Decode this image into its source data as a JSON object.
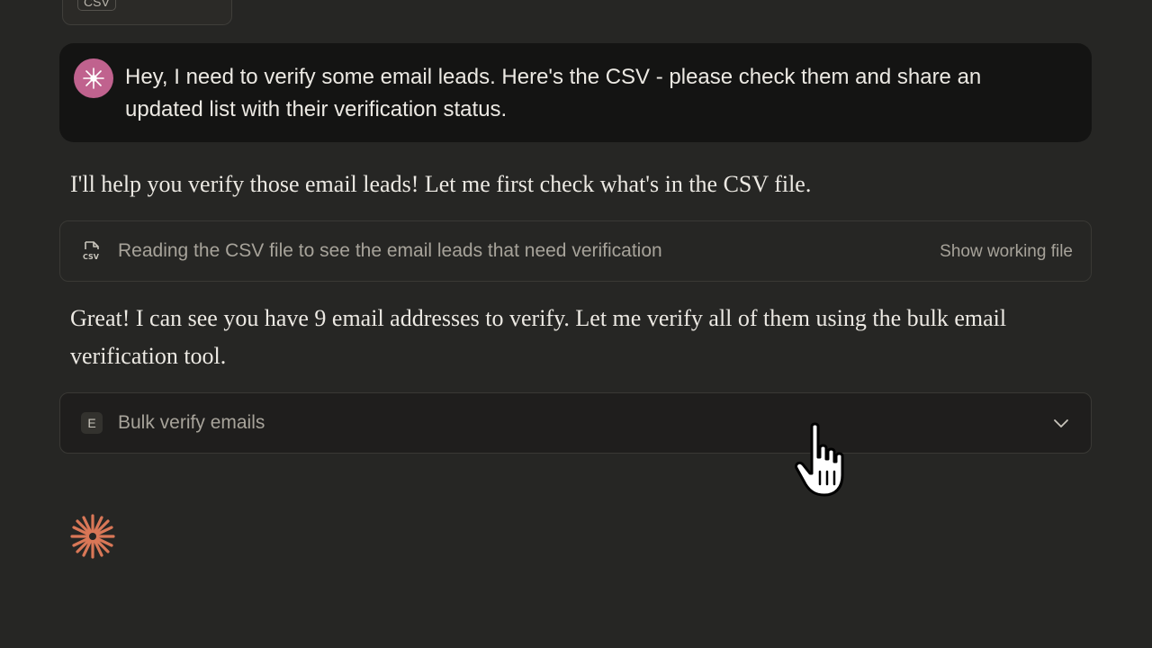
{
  "attachment": {
    "tag": "CSV"
  },
  "user_message": {
    "text": "Hey, I need to verify some email leads. Here's the CSV - please check them and share an updated list with their verification status."
  },
  "assistant": {
    "text_1": "I'll help you verify those email leads! Let me first check what's in the CSV file.",
    "text_2": "Great! I can see you have 9 email addresses to verify. Let me verify all of them using the bulk email verification tool."
  },
  "tool_read": {
    "icon": "csv-file-icon",
    "label": "Reading the CSV file to see the email leads that need verification",
    "action": "Show working file"
  },
  "tool_bulk": {
    "badge": "E",
    "label": "Bulk verify emails",
    "icon": "chevron-down-icon"
  },
  "colors": {
    "background": "#262624",
    "user_bubble": "#141413",
    "avatar": "#c0628e",
    "spark": "#d97757"
  }
}
